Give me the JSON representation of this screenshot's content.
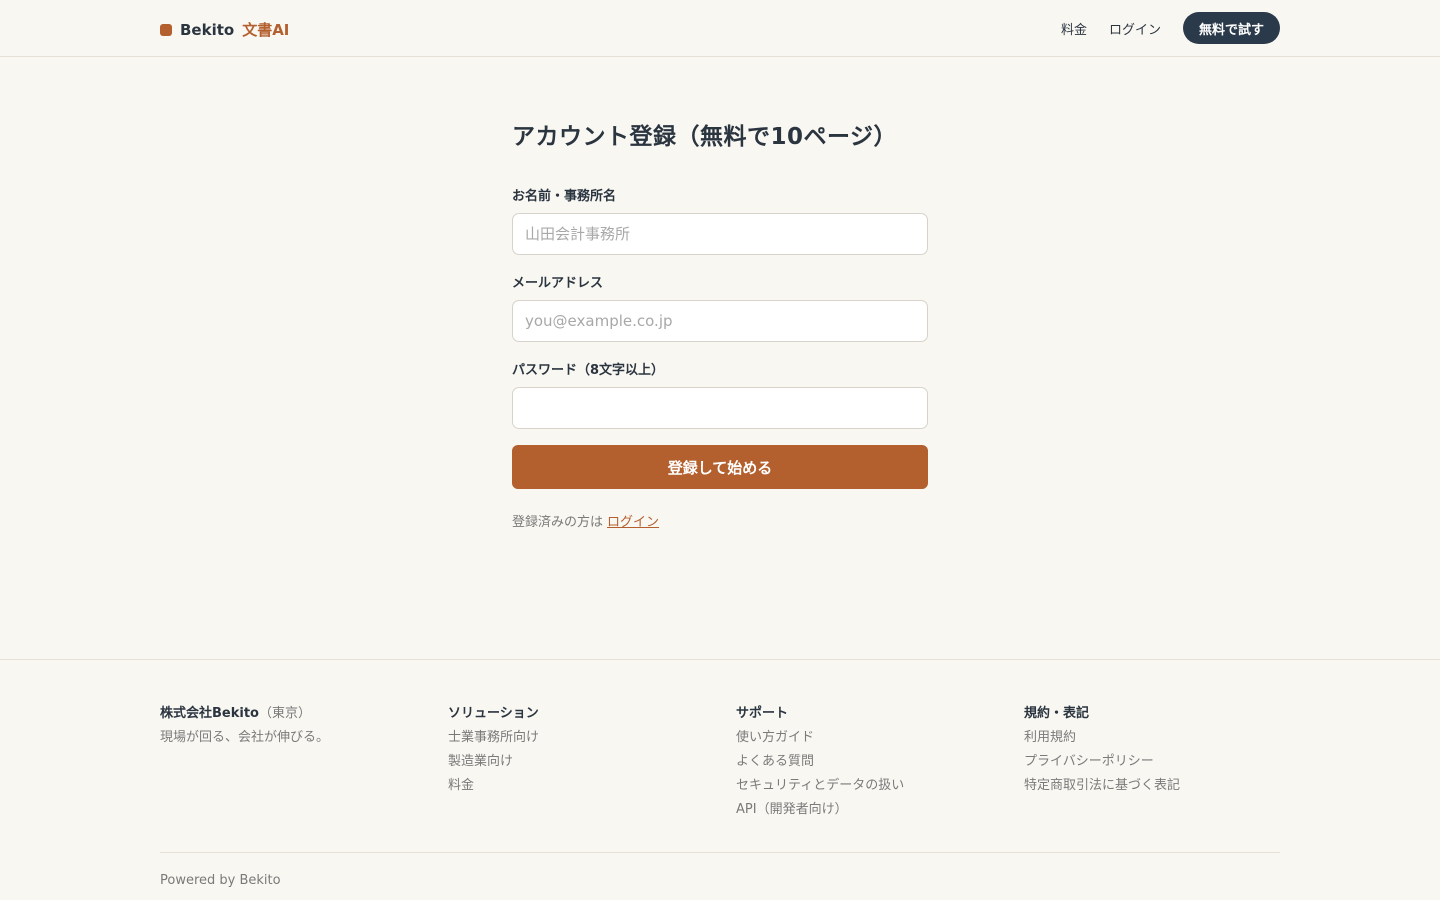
{
  "header": {
    "brand_name": "Bekito",
    "brand_product": "文書AI",
    "nav": {
      "pricing": "料金",
      "login": "ログイン",
      "cta": "無料で試す"
    }
  },
  "form": {
    "title": "アカウント登録（無料で10ページ）",
    "name_label": "お名前・事務所名",
    "name_placeholder": "山田会計事務所",
    "name_value": "",
    "email_label": "メールアドレス",
    "email_placeholder": "you@example.co.jp",
    "email_value": "",
    "password_label": "パスワード（8文字以上）",
    "password_value": "",
    "submit_label": "登録して始める",
    "login_hint": "登録済みの方は",
    "login_link": "ログイン"
  },
  "footer": {
    "company": {
      "name": "株式会社Bekito",
      "location": "（東京）",
      "tagline": "現場が回る、会社が伸びる。"
    },
    "solutions": {
      "title": "ソリューション",
      "links": [
        "士業事務所向け",
        "製造業向け",
        "料金"
      ]
    },
    "support": {
      "title": "サポート",
      "links": [
        "使い方ガイド",
        "よくある質問",
        "セキュリティとデータの扱い",
        "API（開発者向け）"
      ]
    },
    "legal": {
      "title": "規約・表記",
      "links": [
        "利用規約",
        "プライバシーポリシー",
        "特定商取引法に基づく表記"
      ]
    },
    "powered_by": "Powered by Bekito"
  },
  "colors": {
    "background": "#f9f7f2",
    "accent": "#b35f2e",
    "dark": "#2b3a4a"
  }
}
